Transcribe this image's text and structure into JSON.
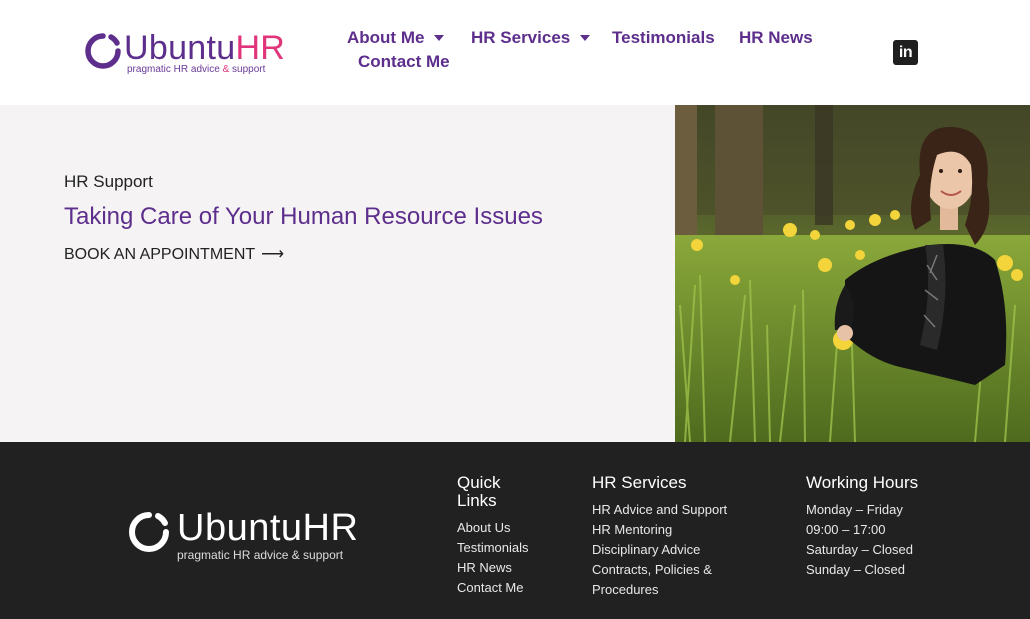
{
  "header": {
    "logo": {
      "word_main": "Ubuntu",
      "word_accent": "HR",
      "tagline_pre": "pragmatic HR advice ",
      "tagline_amp": "&",
      "tagline_post": " support"
    },
    "nav": {
      "about": "About Me",
      "services": "HR Services",
      "testimonials": "Testimonials",
      "news": "HR News",
      "contact": "Contact Me"
    },
    "social": {
      "linkedin_label": "in",
      "icon": "linkedin-icon"
    }
  },
  "hero": {
    "kicker": "HR Support",
    "title": "Taking Care of Your Human Resource Issues",
    "cta": "BOOK AN APPOINTMENT",
    "cta_arrow": "⟶",
    "photo": "woman-in-daffodil-field"
  },
  "footer": {
    "logo": {
      "word": "UbuntuHR",
      "tagline": "pragmatic HR advice & support"
    },
    "quick_links": {
      "title_line1": "Quick",
      "title_line2": "Links",
      "items": [
        "About Us",
        "Testimonials",
        "HR News",
        "Contact Me"
      ]
    },
    "services": {
      "title": "HR Services",
      "items": [
        "HR Advice and Support",
        "HR Mentoring",
        "Disciplinary Advice",
        "Contracts, Policies &",
        "Procedures"
      ]
    },
    "hours": {
      "title": "Working Hours",
      "items": [
        "Monday – Friday",
        "09:00 – 17:00",
        "Saturday – Closed",
        "Sunday – Closed"
      ]
    }
  },
  "colors": {
    "brand_purple": "#5d2e8c",
    "brand_pink": "#e0357a",
    "footer_bg": "#222121",
    "hero_bg": "#f5f3f4"
  }
}
